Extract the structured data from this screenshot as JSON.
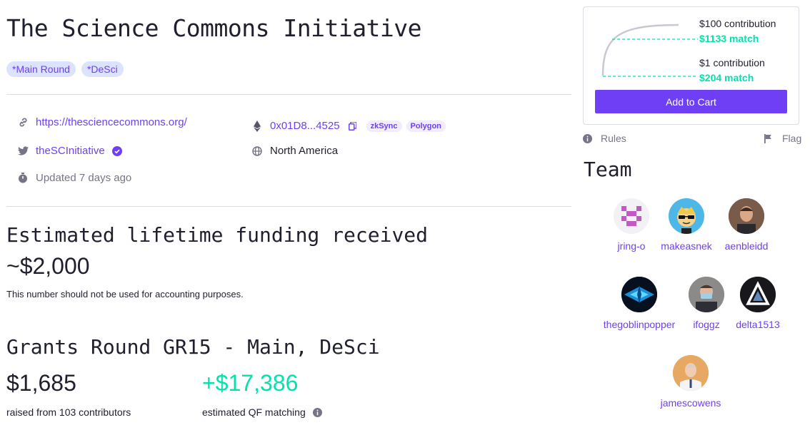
{
  "project": {
    "title": "The Science Commons Initiative",
    "tags": [
      "*Main Round",
      "*DeSci"
    ]
  },
  "details": {
    "website": "https://thesciencecommons.org/",
    "twitter": "theSCInitiative",
    "updated": "Updated 7 days ago",
    "address": "0x01D8...4525",
    "chains": [
      "zkSync",
      "Polygon"
    ],
    "region": "North America"
  },
  "funding": {
    "heading": "Estimated lifetime funding received",
    "amount": "~$2,000",
    "note": "This number should not be used for accounting purposes."
  },
  "round": {
    "heading": "Grants Round GR15 - Main, DeSci",
    "raised": "$1,685",
    "raised_label": "raised from 103 contributors",
    "matching": "+$17,386",
    "matching_label": "estimated QF matching"
  },
  "match_card": {
    "top_label": "$100 contribution",
    "top_match": "$1133 match",
    "bottom_label": "$1 contribution",
    "bottom_match": "$204 match",
    "button": "Add to Cart"
  },
  "links": {
    "rules": "Rules",
    "flag": "Flag"
  },
  "team": {
    "title": "Team",
    "members": [
      "jring-o",
      "makeasnek",
      "aenbleidd",
      "thegoblinpopper",
      "ifoggz",
      "delta1513",
      "jamescowens"
    ]
  },
  "colors": {
    "accent": "#6f3ff5",
    "match": "#02e2ac",
    "tag_bg": "#dbe3ff"
  }
}
